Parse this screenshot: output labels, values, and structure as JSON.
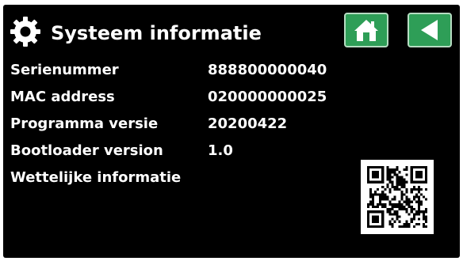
{
  "header": {
    "title": "Systeem informatie",
    "icon": "gear-icon",
    "home_icon": "home-icon",
    "back_icon": "back-arrow-icon"
  },
  "info_rows": [
    {
      "label": "Serienummer",
      "value": "888800000040"
    },
    {
      "label": "MAC address",
      "value": "020000000025"
    },
    {
      "label": "Programma versie",
      "value": "20200422"
    },
    {
      "label": "Bootloader version",
      "value": "1.0"
    },
    {
      "label": "Wettelijke informatie",
      "value": ""
    }
  ],
  "qr_code": {
    "icon": "qr-code-icon"
  },
  "colors": {
    "background": "#000000",
    "text": "#ffffff",
    "button": "#2e9e57",
    "button_border": "#b6dcc2"
  }
}
